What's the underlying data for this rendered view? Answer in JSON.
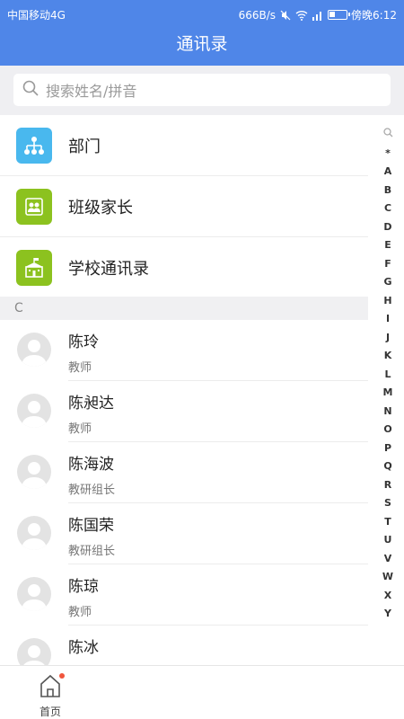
{
  "status_bar": {
    "carrier": "中国移动4G",
    "speed": "666B/s",
    "time": "傍晚6:12"
  },
  "header": {
    "title": "通讯录"
  },
  "search": {
    "placeholder": "搜索姓名/拼音"
  },
  "categories": [
    {
      "label": "部门",
      "icon": "org-chart-icon",
      "color": "#49b8ee"
    },
    {
      "label": "班级家长",
      "icon": "people-icon",
      "color": "#8cc21f"
    },
    {
      "label": "学校通讯录",
      "icon": "school-icon",
      "color": "#8cc21f"
    }
  ],
  "section_letter": "C",
  "contacts": [
    {
      "name": "陈玲",
      "role": "教师"
    },
    {
      "name": "陈昶达",
      "role": "教师"
    },
    {
      "name": "陈海波",
      "role": "教研组长"
    },
    {
      "name": "陈国荣",
      "role": "教研组长"
    },
    {
      "name": "陈琼",
      "role": "教师"
    },
    {
      "name": "陈冰",
      "role": ""
    }
  ],
  "index_letters": [
    "*",
    "A",
    "B",
    "C",
    "D",
    "E",
    "F",
    "G",
    "H",
    "I",
    "J",
    "K",
    "L",
    "M",
    "N",
    "O",
    "P",
    "Q",
    "R",
    "S",
    "T",
    "U",
    "V",
    "W",
    "X",
    "Y"
  ],
  "tabbar": {
    "home_label": "首页"
  }
}
